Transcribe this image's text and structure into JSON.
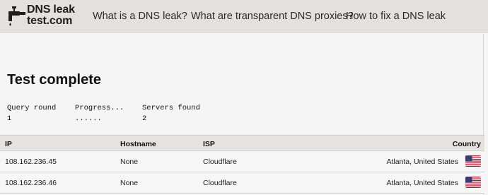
{
  "header": {
    "logo_line1": "DNS leak",
    "logo_line2": "test.com",
    "nav": [
      "What is a DNS leak?",
      "What are transparent DNS proxies?",
      "How to fix a DNS leak"
    ]
  },
  "main": {
    "title": "Test complete",
    "status": {
      "query_round_label": "Query round",
      "query_round_value": "1",
      "progress_label": "Progress...",
      "progress_value": "......",
      "servers_found_label": "Servers found",
      "servers_found_value": "2"
    }
  },
  "table": {
    "headers": [
      "IP",
      "Hostname",
      "ISP",
      "Country"
    ],
    "rows": [
      {
        "ip": "108.162.236.45",
        "hostname": "None",
        "isp": "Cloudflare",
        "country": "Atlanta, United States",
        "flag": "us-flag-icon"
      },
      {
        "ip": "108.162.236.46",
        "hostname": "None",
        "isp": "Cloudflare",
        "country": "Atlanta, United States",
        "flag": "us-flag-icon"
      }
    ]
  },
  "colors": {
    "navbar_bg": "#e2e1de",
    "page_bg": "#f5f5f5",
    "table_header_bg": "#e4e3e0"
  }
}
